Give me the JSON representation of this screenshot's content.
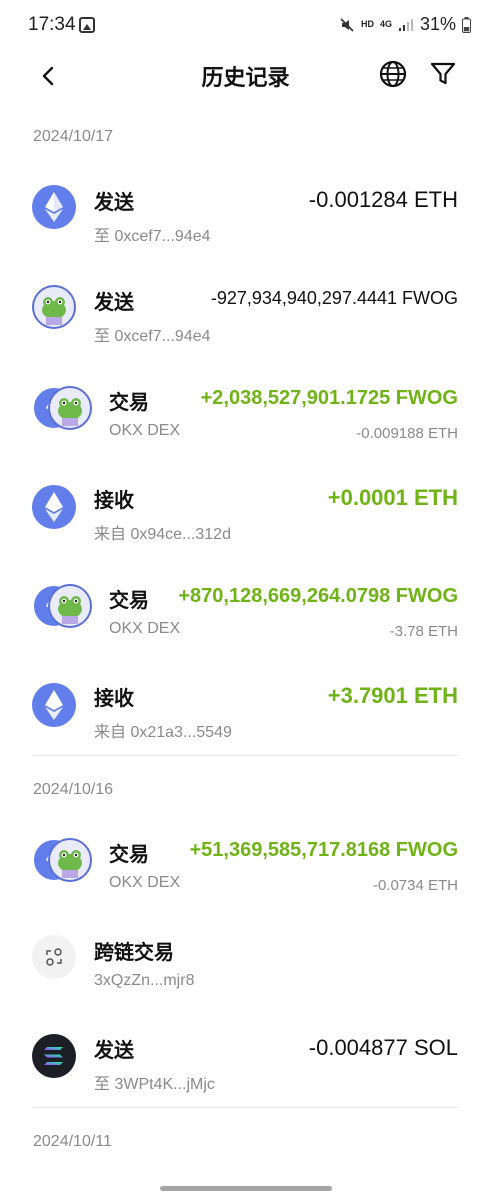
{
  "status_bar": {
    "time": "17:34",
    "network": "HD",
    "signal_label": "4G",
    "battery": "31%"
  },
  "header": {
    "title": "历史记录"
  },
  "sections": [
    {
      "date": "2024/10/17",
      "items": [
        {
          "type": "发送",
          "sub": "至 0xcef7...94e4",
          "amount": "-0.001284 ETH",
          "secondary": "",
          "icon": "eth-icon"
        },
        {
          "type": "发送",
          "sub": "至 0xcef7...94e4",
          "amount": "-927,934,940,297.4441 FWOG",
          "secondary": "",
          "icon": "fwog-icon"
        },
        {
          "type": "交易",
          "sub": "OKX DEX",
          "amount": "+2,038,527,901.1725 FWOG",
          "secondary": "-0.009188 ETH",
          "icon": "swap-icon"
        },
        {
          "type": "接收",
          "sub": "来自 0x94ce...312d",
          "amount": "+0.0001 ETH",
          "secondary": "",
          "icon": "eth-icon"
        },
        {
          "type": "交易",
          "sub": "OKX DEX",
          "amount": "+870,128,669,264.0798 FWOG",
          "secondary": "-3.78 ETH",
          "icon": "swap-icon"
        },
        {
          "type": "接收",
          "sub": "来自 0x21a3...5549",
          "amount": "+3.7901 ETH",
          "secondary": "",
          "icon": "eth-icon"
        }
      ]
    },
    {
      "date": "2024/10/16",
      "items": [
        {
          "type": "交易",
          "sub": "OKX DEX",
          "amount": "+51,369,585,717.8168 FWOG",
          "secondary": "-0.0734 ETH",
          "icon": "swap-icon"
        },
        {
          "type": "跨链交易",
          "sub": "3xQzZn...mjr8",
          "amount": "",
          "secondary": "",
          "icon": "bridge-icon"
        },
        {
          "type": "发送",
          "sub": "至 3WPt4K...jMjc",
          "amount": "-0.004877 SOL",
          "secondary": "",
          "icon": "sol-icon"
        }
      ]
    },
    {
      "date": "2024/10/11",
      "items": []
    }
  ],
  "colors": {
    "positive": "#6fb316",
    "eth": "#627eea",
    "muted": "#8a8a8a"
  }
}
